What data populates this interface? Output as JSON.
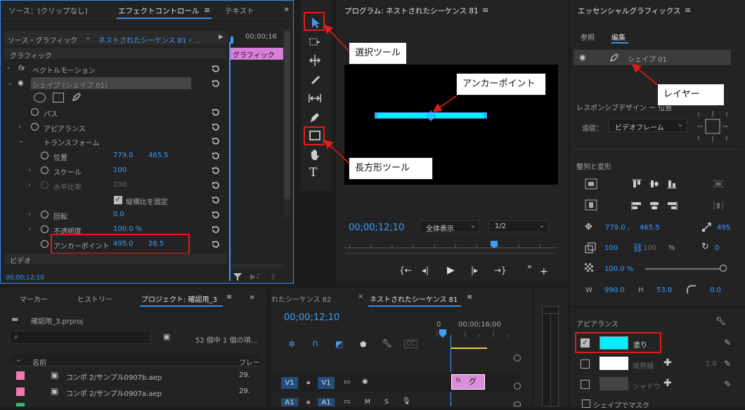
{
  "effect_controls": {
    "tab_source": "ソース：(クリップなし)",
    "tab_effect": "エフェクトコントロール",
    "tab_text": "テキスト",
    "source_label": "ソース・グラフィック",
    "sequence_label": "ネストされたシーケンス 81・...",
    "timecode_header": "00;00;16",
    "clip_label": "グラフィック",
    "section_graphic": "グラフィック",
    "vector_motion": "ベクトルモーション",
    "shape_layer": "シェイプ (シェイプ 01)",
    "path": "パス",
    "appearance": "アピアランス",
    "transform": "トランスフォーム",
    "position_label": "位置",
    "position_x": "779.0",
    "position_y": "465.5",
    "scale_label": "スケール",
    "scale_value": "100",
    "hscale_label": "水平比率",
    "hscale_value": "100",
    "lock_aspect": "縦横比を固定",
    "rotation_label": "回転",
    "rotation_value": "0.0",
    "opacity_label": "不透明度",
    "opacity_value": "100.0 %",
    "anchor_label": "アンカーポイント",
    "anchor_x": "495.0",
    "anchor_y": "26.5",
    "section_video": "ビデオ",
    "footer_time": "00;00;12;10"
  },
  "program": {
    "title": "プログラム: ネストされたシーケンス 81",
    "timecode": "00;00;12;10",
    "zoom": "全体表示",
    "resolution": "1/2"
  },
  "essential": {
    "title": "エッセンシャルグラフィックス",
    "tab_browse": "参照",
    "tab_edit": "編集",
    "layer_name": "シェイプ 01",
    "responsive_label": "レスポンシブデザイン ー 位置",
    "follow_label": "追従：",
    "follow_value": "ビデオフレーム",
    "align_label": "整列と変形",
    "pos_x": "779.0 ,",
    "pos_y": "465.5",
    "anchor_val": "495.",
    "scale_val": "100",
    "scale_val2": "100",
    "scale_unit": "%",
    "rot_val": "0",
    "opacity_val": "100.0 %",
    "w_label": "W",
    "w_val": "990.0",
    "h_label": "H",
    "h_val": "53.0",
    "corner_val": "0.0",
    "appearance_label": "アピアランス",
    "fill_label": "塗り",
    "stroke_label": "境界線",
    "stroke_val": "1.0",
    "shadow_label": "シャドウ",
    "mask_label": "シェイプでマスク",
    "fill_color": "#00f0ff"
  },
  "project": {
    "tab_markers": "マーカー",
    "tab_history": "ヒストリー",
    "tab_project": "プロジェクト: 確認用_3",
    "file_name": "確認用_3.prproj",
    "count_text": "52 個中 1 個の項...",
    "col_name": "名前",
    "col_frame": "フレー",
    "items": [
      {
        "name": "コンポ 2/サンプル0907b.aep",
        "rate": "29."
      },
      {
        "name": "コンポ 2/サンプル0907a.aep",
        "rate": "29."
      }
    ]
  },
  "timeline": {
    "tab_prev": "れたシーケンス 82",
    "tab_active": "ネストされたシーケンス 81",
    "timecode": "00;00;12;10",
    "ruler_0": "0",
    "ruler_16": "00;00;16;00",
    "v1": "V1",
    "a1": "A1",
    "clip_text": "グ"
  },
  "callouts": {
    "select_tool": "選択ツール",
    "anchor_point": "アンカーポイント",
    "rect_tool": "長方形ツール",
    "layer": "レイヤー"
  }
}
